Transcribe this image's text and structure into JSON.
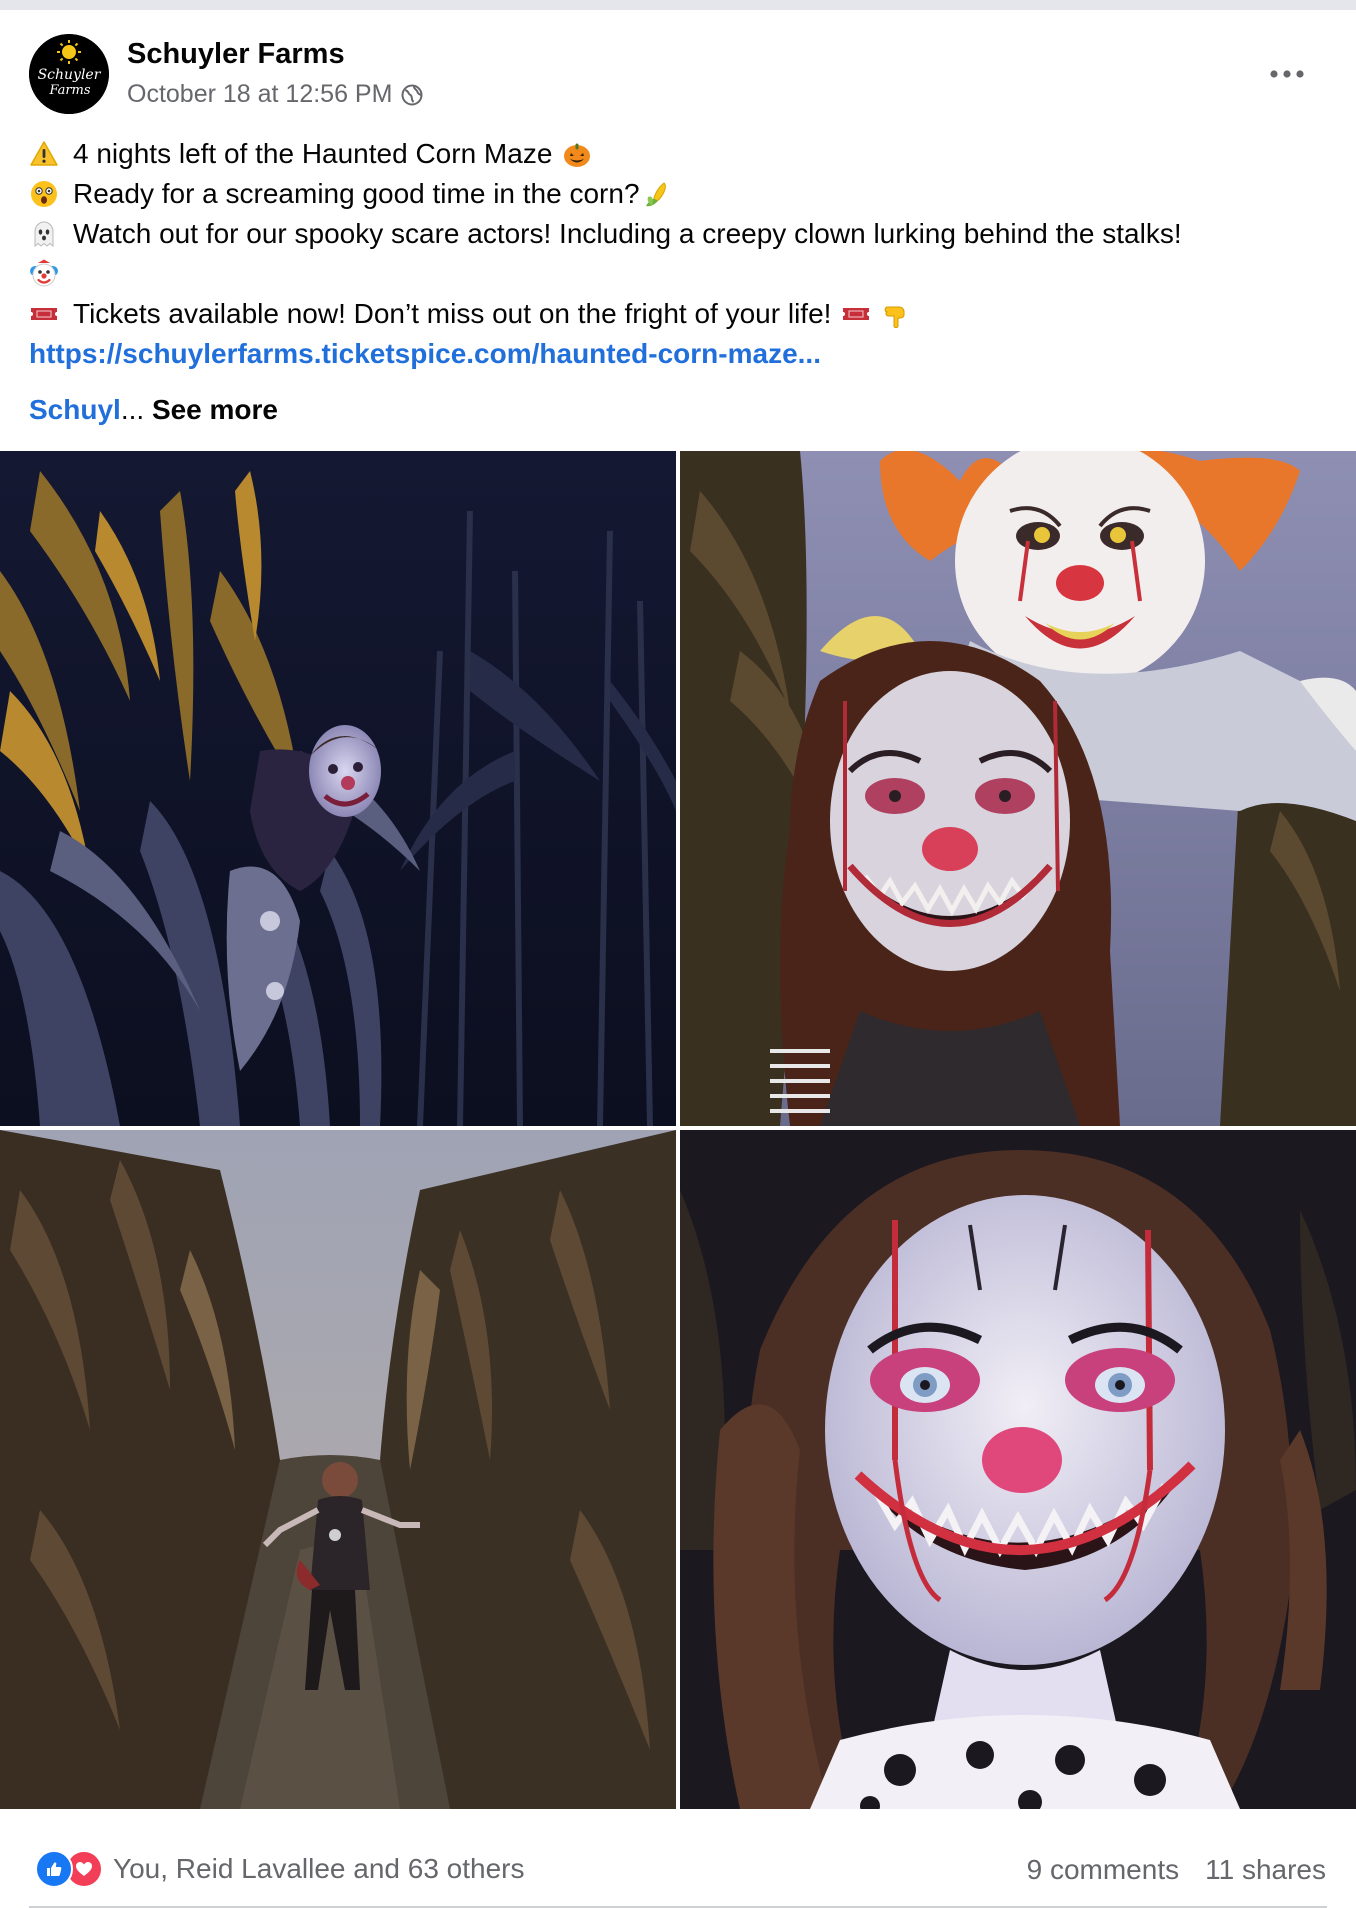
{
  "post": {
    "author": "Schuyler Farms",
    "logo_text": "Schuyler Farms",
    "timestamp": "October 18 at 12:56 PM",
    "audience_icon": "globe-icon",
    "more_icon": "more-options-icon",
    "lines": [
      {
        "lead_icon": "warning-emoji",
        "text": "4 nights left of the Haunted Corn Maze",
        "trail_icon": "jack-o-lantern-emoji"
      },
      {
        "lead_icon": "astonished-face-emoji",
        "text": "Ready for a screaming good time in the corn?",
        "trail_icon": "corn-emoji"
      },
      {
        "lead_icon": "ghost-emoji",
        "text": "Watch out for our spooky scare actors! Including a creepy clown lurking behind the stalks!"
      },
      {
        "lead_icon": "clown-emoji",
        "text": ""
      },
      {
        "lead_icon": "ticket-emoji",
        "text": "Tickets available now! Don’t miss out on the fright of your life!",
        "trail_icons": [
          "ticket-emoji",
          "pointing-down-emoji"
        ]
      }
    ],
    "link": "https://schuylerfarms.ticketspice.com/haunted-corn-maze...",
    "tag_text": "Schuyl",
    "ellipsis": "...",
    "see_more": "See more"
  },
  "photos": [
    {
      "name": "photo-clown-in-dark-corn",
      "subject": "clown actor peering from dark cornstalks"
    },
    {
      "name": "photo-clown-selfie-with-inflatable",
      "subject": "clown makeup selfie with inflatable clown"
    },
    {
      "name": "photo-clown-in-corn-path",
      "subject": "clown actor standing in corn maze path"
    },
    {
      "name": "photo-clown-face-closeup",
      "subject": "close-up clown makeup face"
    }
  ],
  "footer": {
    "reaction_icons": [
      "like-icon",
      "love-icon"
    ],
    "reactors": "You, Reid Lavallee and 63 others",
    "comments": "9 comments",
    "shares": "11 shares"
  },
  "colors": {
    "link": "#216fdb",
    "secondary_text": "#65676b",
    "like_blue": "#1877f2",
    "love_red": "#f33e58"
  }
}
